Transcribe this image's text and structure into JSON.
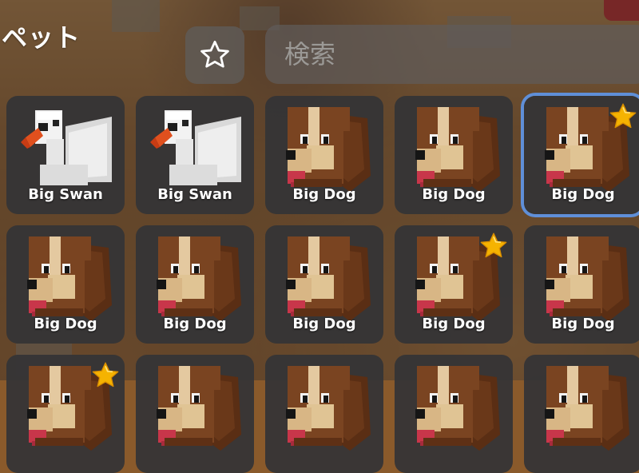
{
  "header": {
    "title": "ペット",
    "favorite_icon": "star-outline-icon",
    "search_placeholder": "検索"
  },
  "pets": [
    {
      "name": "Big Swan",
      "kind": "swan",
      "starred": false,
      "selected": false
    },
    {
      "name": "Big Swan",
      "kind": "swan",
      "starred": false,
      "selected": false
    },
    {
      "name": "Big Dog",
      "kind": "dog",
      "starred": false,
      "selected": false
    },
    {
      "name": "Big Dog",
      "kind": "dog",
      "starred": false,
      "selected": false
    },
    {
      "name": "Big Dog",
      "kind": "dog",
      "starred": true,
      "selected": true
    },
    {
      "name": "Big Dog",
      "kind": "dog",
      "starred": false,
      "selected": false
    },
    {
      "name": "Big Dog",
      "kind": "dog",
      "starred": false,
      "selected": false
    },
    {
      "name": "Big Dog",
      "kind": "dog",
      "starred": false,
      "selected": false
    },
    {
      "name": "Big Dog",
      "kind": "dog",
      "starred": true,
      "selected": false
    },
    {
      "name": "Big Dog",
      "kind": "dog",
      "starred": false,
      "selected": false
    },
    {
      "name": "",
      "kind": "dog",
      "starred": true,
      "selected": false
    },
    {
      "name": "",
      "kind": "dog",
      "starred": false,
      "selected": false
    },
    {
      "name": "",
      "kind": "dog",
      "starred": false,
      "selected": false
    },
    {
      "name": "",
      "kind": "dog",
      "starred": false,
      "selected": false
    },
    {
      "name": "",
      "kind": "dog",
      "starred": false,
      "selected": false
    }
  ],
  "colors": {
    "accent_selection": "#5f8fd8",
    "star": "#f5b301",
    "tile_bg": "#343436"
  }
}
